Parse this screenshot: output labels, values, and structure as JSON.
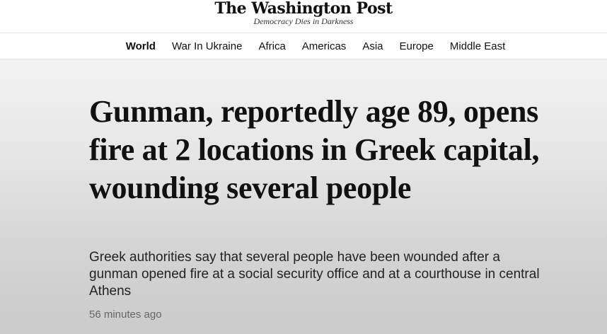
{
  "masthead": {
    "logo_text": "The Washington Post",
    "tagline": "Democracy Dies in Darkness"
  },
  "nav": {
    "items": [
      {
        "label": "World",
        "active": true
      },
      {
        "label": "War In Ukraine",
        "active": false
      },
      {
        "label": "Africa",
        "active": false
      },
      {
        "label": "Americas",
        "active": false
      },
      {
        "label": "Asia",
        "active": false
      },
      {
        "label": "Europe",
        "active": false
      },
      {
        "label": "Middle East",
        "active": false
      }
    ]
  },
  "article": {
    "headline": "Gunman, reportedly age 89, opens fire at 2 locations in Greek capital, wounding several people",
    "dek": "Greek authorities say that several people have been wounded after a gunman opened fire at a social security office and at a courthouse in central Athens",
    "timestamp": "56 minutes ago"
  },
  "colors": {
    "text": "#111111",
    "meta": "#666666",
    "hero_top": "#f3f3f3",
    "hero_bottom": "#cbcbcb"
  }
}
